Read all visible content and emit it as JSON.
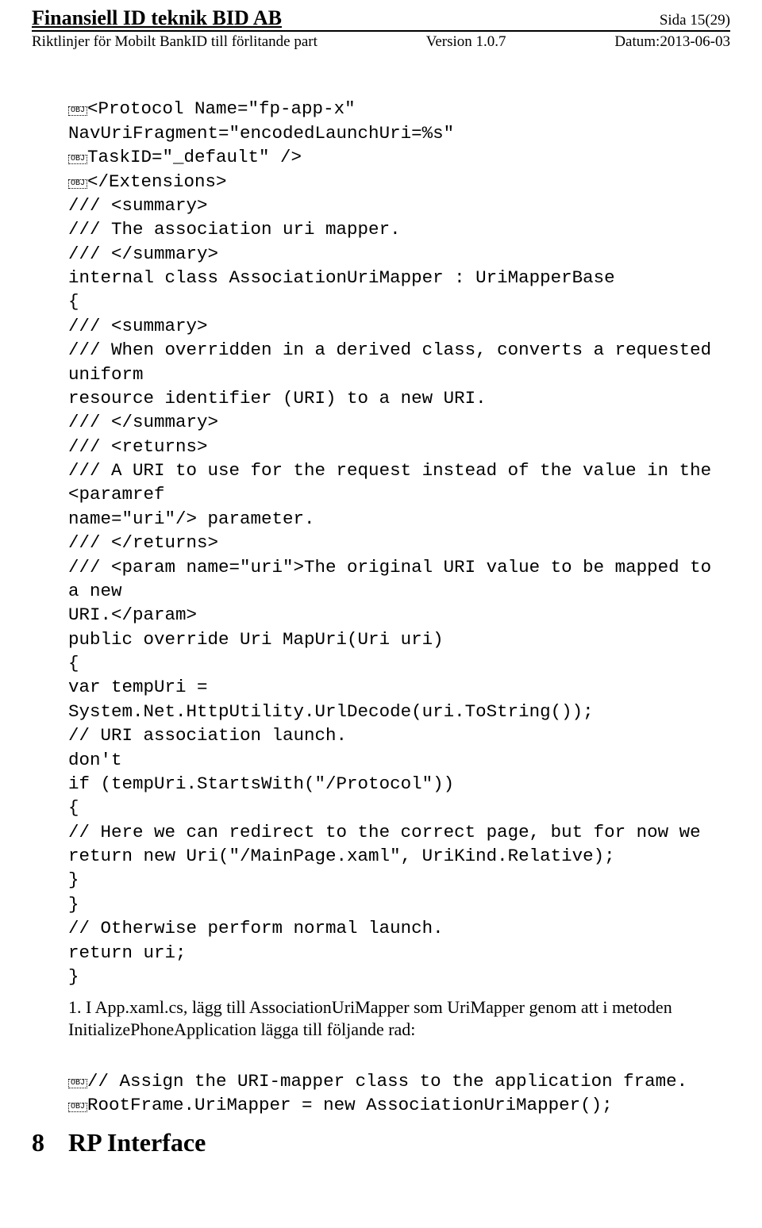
{
  "header": {
    "title_left": "Finansiell ID teknik BID AB",
    "title_right": "Sida 15(29)",
    "sub_left": "Riktlinjer för Mobilt BankID till förlitande part",
    "sub_center": "Version 1.0.7",
    "sub_right": "Datum:2013-06-03"
  },
  "marker": "OBJ",
  "code": {
    "l1a": "<Protocol Name=\"fp-app-x\"",
    "l1b": "NavUriFragment=\"encodedLaunchUri=%s\"",
    "l2": "TaskID=\"_default\" />",
    "l3": "</Extensions>",
    "l4": "/// <summary>",
    "l5": "/// The association uri mapper.",
    "l6": "/// </summary>",
    "l7": "internal class AssociationUriMapper : UriMapperBase",
    "l8": "{",
    "l9": "/// <summary>",
    "l10": "/// When overridden in a derived class, converts a requested uniform",
    "l11": "resource identifier (URI) to a new URI.",
    "l12": "/// </summary>",
    "l13": "/// <returns>",
    "l14": "/// A URI to use for the request instead of the value in the <paramref",
    "l15": "name=\"uri\"/> parameter.",
    "l16": "/// </returns>",
    "l17": "/// <param name=\"uri\">The original URI value to be mapped to a new",
    "l18": "URI.</param>",
    "l19": "public override Uri MapUri(Uri uri)",
    "l20": "{",
    "l21": "var tempUri =",
    "l22": "System.Net.HttpUtility.UrlDecode(uri.ToString());",
    "l23": "// URI association launch.",
    "l24": "don't",
    "l25": "if (tempUri.StartsWith(\"/Protocol\"))",
    "l26": "{",
    "l27": "// Here we can redirect to the correct page, but for now we",
    "l28": "return new Uri(\"/MainPage.xaml\", UriKind.Relative);",
    "l29": "}",
    "l30": "}",
    "l31": "// Otherwise perform normal launch.",
    "l32": "return uri;",
    "l33": "}",
    "l34": "// Assign the URI-mapper class to the application frame.",
    "l35": "RootFrame.UriMapper = new AssociationUriMapper();"
  },
  "list_item": "1. I App.xaml.cs, lägg till AssociationUriMapper som UriMapper genom att i metoden InitializePhoneApplication lägga till följande rad:",
  "heading": {
    "num": "8",
    "text": "RP Interface"
  }
}
